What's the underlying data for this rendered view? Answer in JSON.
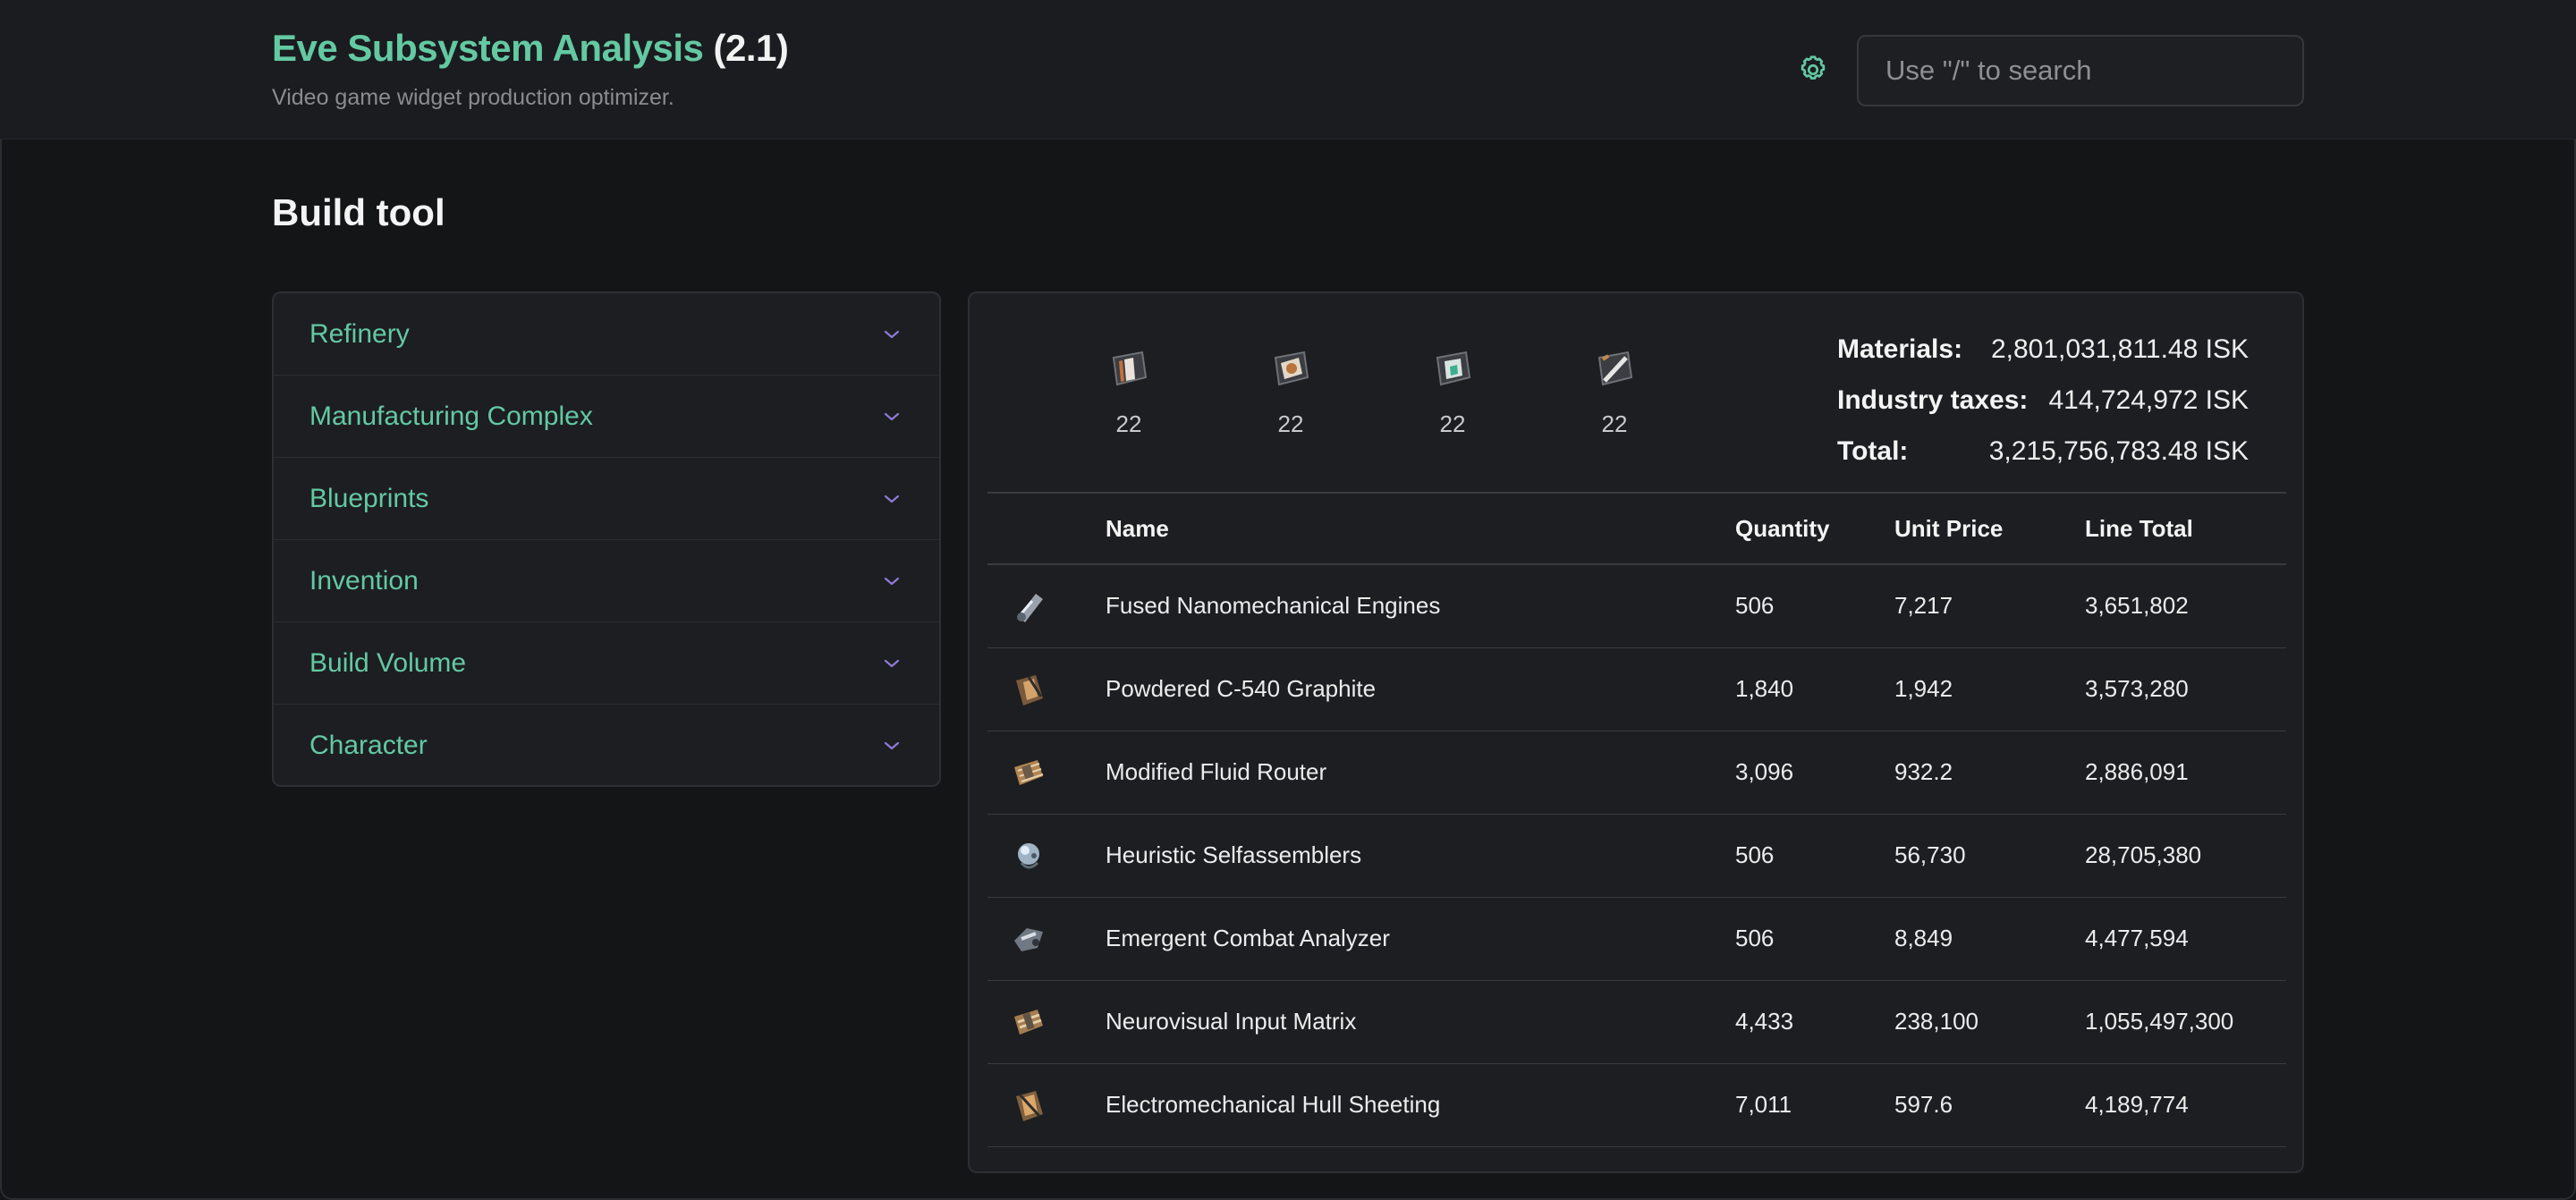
{
  "header": {
    "title": "Eve Subsystem Analysis",
    "version": "(2.1)",
    "subtitle": "Video game widget production optimizer.",
    "settings_icon": "gear-icon",
    "search_placeholder": "Use \"/\" to search"
  },
  "page": {
    "title": "Build tool"
  },
  "accordion": {
    "chevron_icon": "chevron-down-icon",
    "accent_color": "#63c9a3",
    "chevron_color": "#8e7ad6",
    "items": [
      {
        "label": "Refinery"
      },
      {
        "label": "Manufacturing Complex"
      },
      {
        "label": "Blueprints"
      },
      {
        "label": "Invention"
      },
      {
        "label": "Build Volume"
      },
      {
        "label": "Character"
      }
    ]
  },
  "products": [
    {
      "icon": "subsystem-defensive-icon",
      "count": "22"
    },
    {
      "icon": "subsystem-offensive-icon",
      "count": "22"
    },
    {
      "icon": "subsystem-core-icon",
      "count": "22"
    },
    {
      "icon": "subsystem-propulsion-icon",
      "count": "22"
    }
  ],
  "summary": {
    "materials_label": "Materials:",
    "materials_value": "2,801,031,811.48 ISK",
    "taxes_label": "Industry taxes:",
    "taxes_value": "414,724,972 ISK",
    "total_label": "Total:",
    "total_value": "3,215,756,783.48 ISK"
  },
  "table": {
    "headers": {
      "name": "Name",
      "quantity": "Quantity",
      "unit_price": "Unit Price",
      "line_total": "Line Total"
    },
    "rows": [
      {
        "icon": "engine-component-icon",
        "name": "Fused Nanomechanical Engines",
        "quantity": "506",
        "unit_price": "7,217",
        "line_total": "3,651,802"
      },
      {
        "icon": "graphite-component-icon",
        "name": "Powdered C-540 Graphite",
        "quantity": "1,840",
        "unit_price": "1,942",
        "line_total": "3,573,280"
      },
      {
        "icon": "fluid-router-icon",
        "name": "Modified Fluid Router",
        "quantity": "3,096",
        "unit_price": "932.2",
        "line_total": "2,886,091"
      },
      {
        "icon": "selfassembler-icon",
        "name": "Heuristic Selfassemblers",
        "quantity": "506",
        "unit_price": "56,730",
        "line_total": "28,705,380"
      },
      {
        "icon": "combat-analyzer-icon",
        "name": "Emergent Combat Analyzer",
        "quantity": "506",
        "unit_price": "8,849",
        "line_total": "4,477,594"
      },
      {
        "icon": "input-matrix-icon",
        "name": "Neurovisual Input Matrix",
        "quantity": "4,433",
        "unit_price": "238,100",
        "line_total": "1,055,497,300"
      },
      {
        "icon": "hull-sheeting-icon",
        "name": "Electromechanical Hull Sheeting",
        "quantity": "7,011",
        "unit_price": "597.6",
        "line_total": "4,189,774"
      }
    ]
  }
}
